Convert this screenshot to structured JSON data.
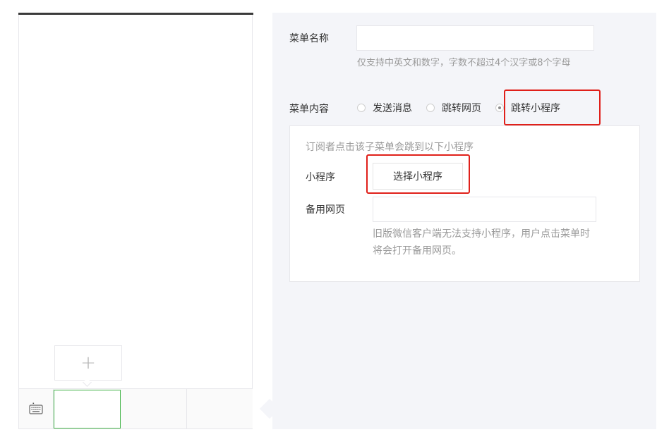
{
  "preview": {
    "add_symbol": "+",
    "keyboard_icon": "keyboard-icon"
  },
  "form": {
    "name_label": "菜单名称",
    "name_value": "",
    "name_hint": "仅支持中英文和数字，字数不超过4个汉字或8个字母",
    "content_label": "菜单内容",
    "options": [
      {
        "label": "发送消息",
        "checked": false
      },
      {
        "label": "跳转网页",
        "checked": false
      },
      {
        "label": "跳转小程序",
        "checked": true
      }
    ]
  },
  "miniprogram": {
    "intro": "订阅者点击该子菜单会跳到以下小程序",
    "program_label": "小程序",
    "select_button": "选择小程序",
    "backup_label": "备用网页",
    "backup_value": "",
    "backup_hint_line1": "旧版微信客户端无法支持小程序，用户点击菜单时",
    "backup_hint_line2": "将会打开备用网页。"
  },
  "colors": {
    "highlight": "#e0201a",
    "active_menu_border": "#44b549",
    "panel_bg": "#f4f5f9"
  }
}
